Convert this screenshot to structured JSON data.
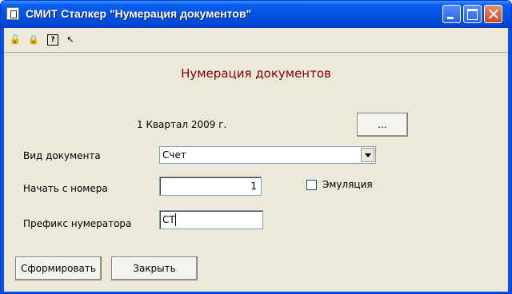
{
  "window": {
    "title": "СМИТ Сталкер \"Нумерация документов\""
  },
  "toolbar": {
    "icons": [
      "lock-open-icon",
      "lock-icon",
      "help-icon",
      "context-help-icon"
    ]
  },
  "form": {
    "heading": "Нумерация документов",
    "period": "1 Квартал 2009 г.",
    "browse_button": "...",
    "doc_type_label": "Вид документа",
    "doc_type_value": "Счет",
    "start_label": "Начать с номера",
    "start_value": "1",
    "emulation_label": "Эмуляция",
    "emulation_checked": false,
    "prefix_label": "Префикс нумератора",
    "prefix_value": "СТ"
  },
  "buttons": {
    "generate": "Сформировать",
    "close": "Закрыть"
  }
}
